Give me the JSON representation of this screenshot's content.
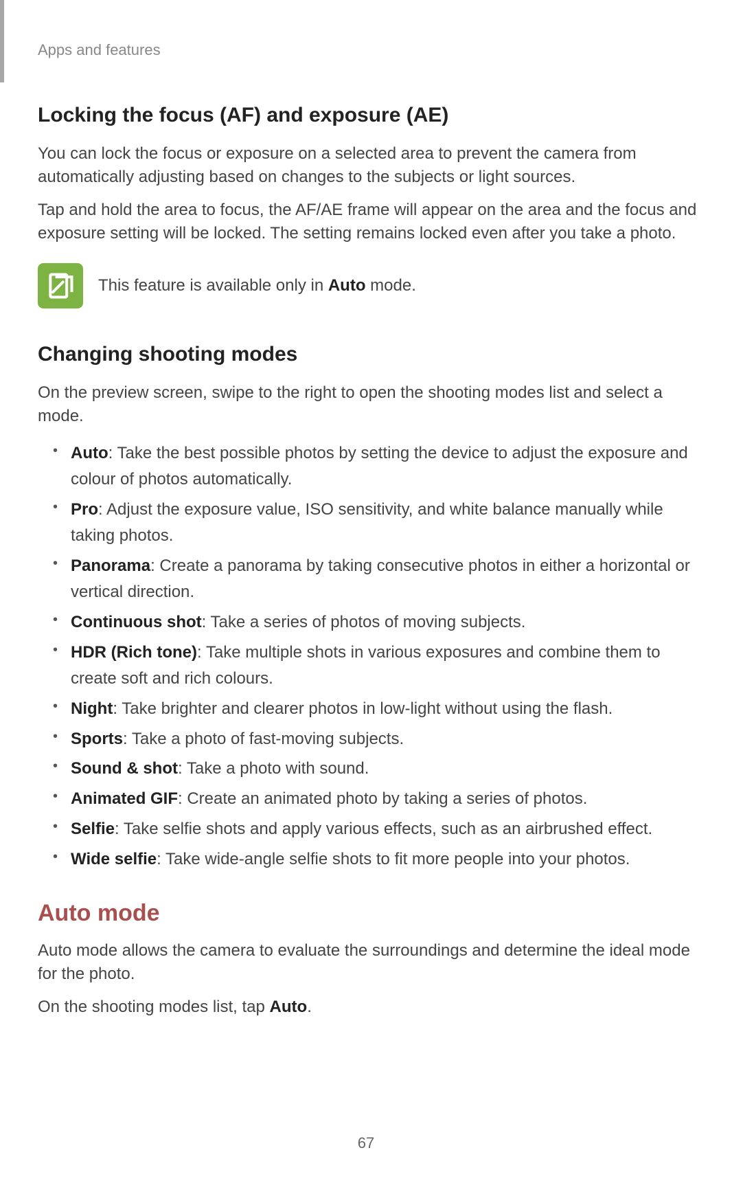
{
  "header": {
    "section_label": "Apps and features"
  },
  "section_lock": {
    "heading": "Locking the focus (AF) and exposure (AE)",
    "p1": "You can lock the focus or exposure on a selected area to prevent the camera from automatically adjusting based on changes to the subjects or light sources.",
    "p2": "Tap and hold the area to focus, the AF/AE frame will appear on the area and the focus and exposure setting will be locked. The setting remains locked even after you take a photo.",
    "note_prefix": "This feature is available only in ",
    "note_bold": "Auto",
    "note_suffix": " mode."
  },
  "section_modes": {
    "heading": "Changing shooting modes",
    "intro": "On the preview screen, swipe to the right to open the shooting modes list and select a mode.",
    "items": [
      {
        "label": "Auto",
        "desc": ": Take the best possible photos by setting the device to adjust the exposure and colour of photos automatically."
      },
      {
        "label": "Pro",
        "desc": ": Adjust the exposure value, ISO sensitivity, and white balance manually while taking photos."
      },
      {
        "label": "Panorama",
        "desc": ": Create a panorama by taking consecutive photos in either a horizontal or vertical direction."
      },
      {
        "label": "Continuous shot",
        "desc": ": Take a series of photos of moving subjects."
      },
      {
        "label": "HDR (Rich tone)",
        "desc": ": Take multiple shots in various exposures and combine them to create soft and rich colours."
      },
      {
        "label": "Night",
        "desc": ": Take brighter and clearer photos in low-light without using the flash."
      },
      {
        "label": "Sports",
        "desc": ": Take a photo of fast-moving subjects."
      },
      {
        "label": "Sound & shot",
        "desc": ": Take a photo with sound."
      },
      {
        "label": "Animated GIF",
        "desc": ": Create an animated photo by taking a series of photos."
      },
      {
        "label": "Selfie",
        "desc": ": Take selfie shots and apply various effects, such as an airbrushed effect."
      },
      {
        "label": "Wide selfie",
        "desc": ": Take wide-angle selfie shots to fit more people into your photos."
      }
    ]
  },
  "section_auto": {
    "heading": "Auto mode",
    "p1": "Auto mode allows the camera to evaluate the surroundings and determine the ideal mode for the photo.",
    "p2_prefix": "On the shooting modes list, tap ",
    "p2_bold": "Auto",
    "p2_suffix": "."
  },
  "page_number": "67"
}
